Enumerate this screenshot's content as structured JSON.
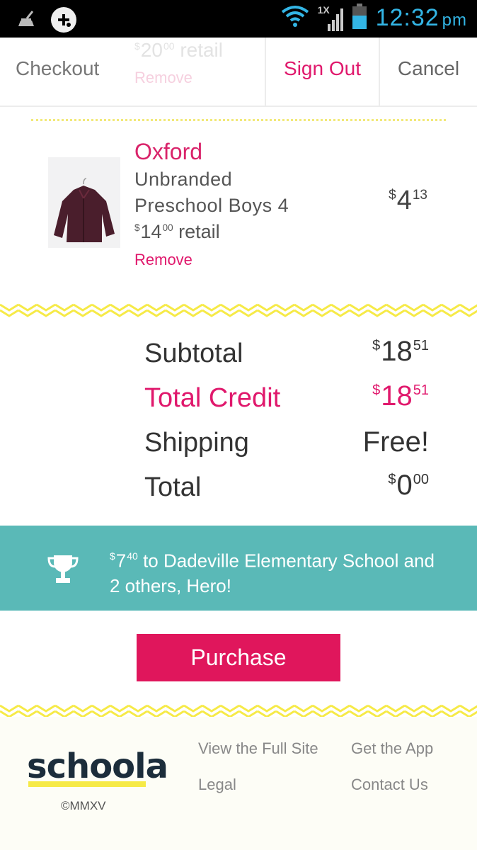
{
  "status_bar": {
    "time": "12:32",
    "ampm": "pm",
    "network": "1X"
  },
  "nav": {
    "checkout": "Checkout",
    "prev_item_price": "20",
    "prev_item_price_cents": "00",
    "prev_item_retail": "retail",
    "prev_item_remove": "Remove",
    "sign_out": "Sign Out",
    "cancel": "Cancel"
  },
  "item": {
    "title": "Oxford",
    "brand": "Unbranded",
    "size": "Preschool Boys 4",
    "retail_dollars": "14",
    "retail_cents": "00",
    "retail_label": "retail",
    "remove": "Remove",
    "price_dollars": "4",
    "price_cents": "13"
  },
  "summary": {
    "subtotal_label": "Subtotal",
    "subtotal_dollars": "18",
    "subtotal_cents": "51",
    "credit_label": "Total Credit",
    "credit_dollars": "18",
    "credit_cents": "51",
    "shipping_label": "Shipping",
    "shipping_value": "Free!",
    "total_label": "Total",
    "total_dollars": "0",
    "total_cents": "00"
  },
  "currency_symbol": "$",
  "hero": {
    "amount_dollars": "7",
    "amount_cents": "40",
    "text": "to Dadeville Elementary School and 2 others, Hero!"
  },
  "purchase_label": "Purchase",
  "footer": {
    "logo": "schoola",
    "copyright": "©MMXV",
    "links": [
      "View the Full Site",
      "Get the App",
      "Legal",
      "Contact Us"
    ]
  },
  "colors": {
    "accent": "#e0186c",
    "hero": "#5ab9b7",
    "zigzag": "#f6ea47"
  }
}
